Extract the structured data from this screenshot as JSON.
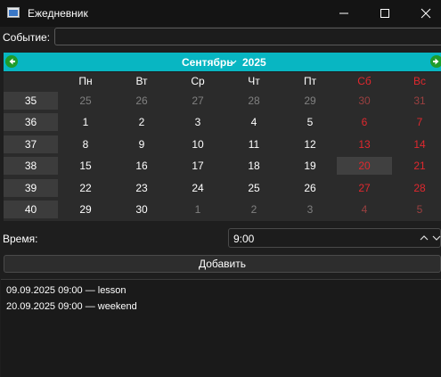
{
  "window": {
    "title": "Ежедневник"
  },
  "event": {
    "label": "Событие:",
    "value": ""
  },
  "calendar": {
    "month": "Сентябрь",
    "year": "2025",
    "weekday_headers": [
      "Пн",
      "Вт",
      "Ср",
      "Чт",
      "Пт",
      "Сб",
      "Вс"
    ],
    "week_numbers": [
      "35",
      "36",
      "37",
      "38",
      "39",
      "40"
    ],
    "days": [
      [
        "25",
        "26",
        "27",
        "28",
        "29",
        "30",
        "31"
      ],
      [
        "1",
        "2",
        "3",
        "4",
        "5",
        "6",
        "7"
      ],
      [
        "8",
        "9",
        "10",
        "11",
        "12",
        "13",
        "14"
      ],
      [
        "15",
        "16",
        "17",
        "18",
        "19",
        "20",
        "21"
      ],
      [
        "22",
        "23",
        "24",
        "25",
        "26",
        "27",
        "28"
      ],
      [
        "29",
        "30",
        "1",
        "2",
        "3",
        "4",
        "5"
      ]
    ],
    "selected_date": "20",
    "colors": {
      "nav_bar": "#08b6c2",
      "nav_arrow": "#1f9c2b",
      "weekend": "#e0282e",
      "weekend_muted": "#9a4040",
      "muted": "#808080",
      "normal": "#ffffff"
    }
  },
  "time": {
    "label": "Время:",
    "value": "9:00"
  },
  "add_button": {
    "label": "Добавить"
  },
  "events": [
    "09.09.2025 09:00 — lesson",
    "20.09.2025 09:00 — weekend"
  ]
}
